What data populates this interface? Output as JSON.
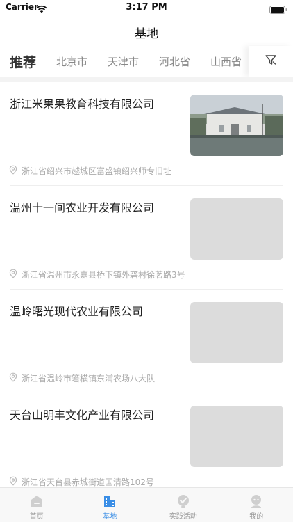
{
  "status_bar": {
    "carrier": "Carrier",
    "time": "3:17 PM"
  },
  "nav": {
    "title": "基地"
  },
  "tabs": [
    {
      "label": "推荐"
    },
    {
      "label": "北京市"
    },
    {
      "label": "天津市"
    },
    {
      "label": "河北省"
    },
    {
      "label": "山西省"
    }
  ],
  "filter_icon": "filter-icon",
  "items": [
    {
      "title": "浙江米果果教育科技有限公司",
      "address": "浙江省绍兴市越城区富盛镇绍兴师专旧址",
      "has_photo": true
    },
    {
      "title": "温州十一间农业开发有限公司",
      "address": "浙江省温州市永嘉县桥下镇外砻村徐茗路3号",
      "has_photo": false
    },
    {
      "title": "温岭曙光现代农业有限公司",
      "address": "浙江省温岭市箬横镇东浦农场八大队",
      "has_photo": false
    },
    {
      "title": "天台山明丰文化产业有限公司",
      "address": "浙江省天台县赤城街道国清路102号",
      "has_photo": false
    }
  ],
  "bottom_tabs": [
    {
      "label": "首页",
      "icon": "home-icon"
    },
    {
      "label": "基地",
      "icon": "base-icon"
    },
    {
      "label": "实践活动",
      "icon": "activity-icon"
    },
    {
      "label": "我的",
      "icon": "profile-icon"
    }
  ],
  "colors": {
    "accent": "#3a8ee6",
    "muted": "#999999",
    "title": "#222222"
  }
}
